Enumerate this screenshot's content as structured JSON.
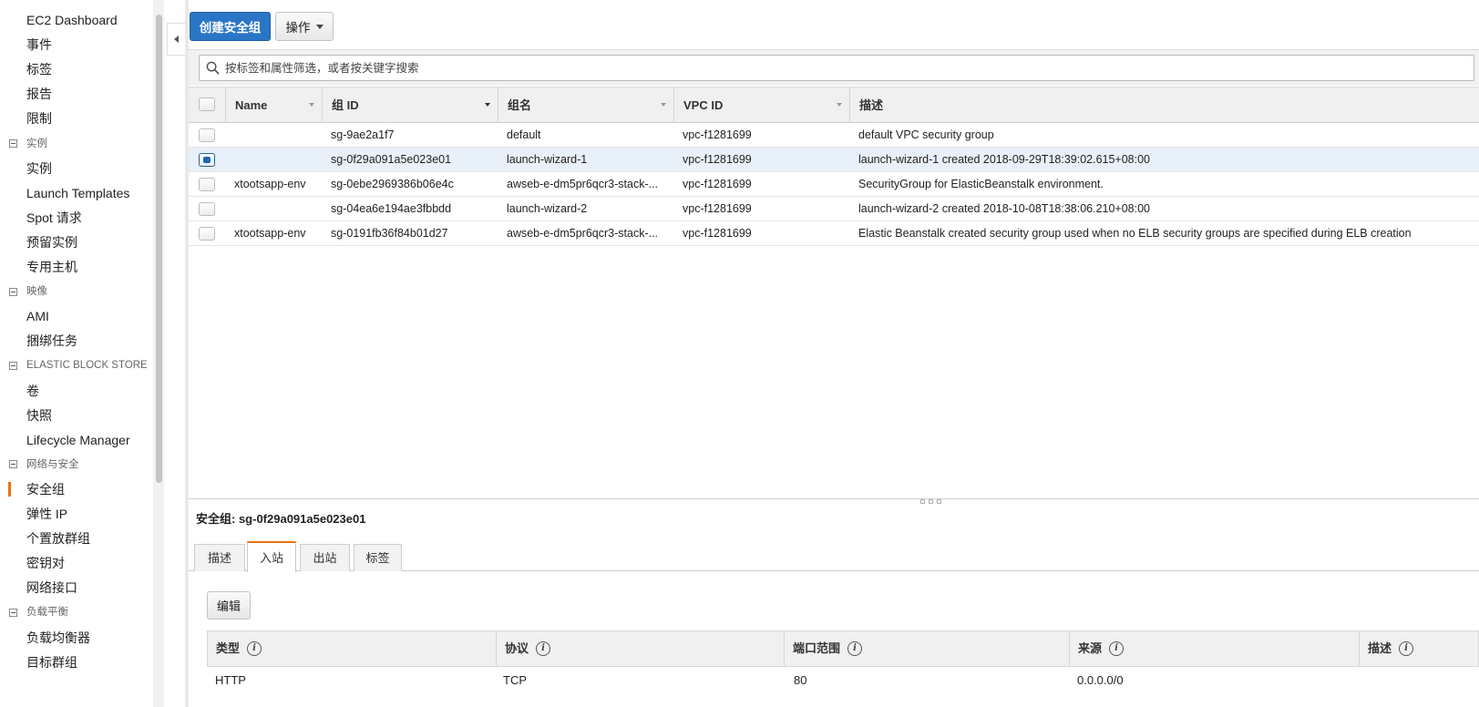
{
  "sidebar": {
    "items": [
      {
        "type": "item",
        "label": "EC2 Dashboard"
      },
      {
        "type": "item",
        "label": "事件"
      },
      {
        "type": "item",
        "label": "标签"
      },
      {
        "type": "item",
        "label": "报告"
      },
      {
        "type": "item",
        "label": "限制"
      },
      {
        "type": "section",
        "label": "实例"
      },
      {
        "type": "item",
        "label": "实例"
      },
      {
        "type": "item",
        "label": "Launch Templates"
      },
      {
        "type": "item",
        "label": "Spot 请求"
      },
      {
        "type": "item",
        "label": "预留实例"
      },
      {
        "type": "item",
        "label": "专用主机"
      },
      {
        "type": "section",
        "label": "映像"
      },
      {
        "type": "item",
        "label": "AMI"
      },
      {
        "type": "item",
        "label": "捆绑任务"
      },
      {
        "type": "section",
        "label": "ELASTIC BLOCK STORE"
      },
      {
        "type": "item",
        "label": "卷"
      },
      {
        "type": "item",
        "label": "快照"
      },
      {
        "type": "item",
        "label": "Lifecycle Manager"
      },
      {
        "type": "section",
        "label": "网络与安全"
      },
      {
        "type": "item",
        "label": "安全组",
        "active": true
      },
      {
        "type": "item",
        "label": "弹性 IP"
      },
      {
        "type": "item",
        "label": "个置放群组"
      },
      {
        "type": "item",
        "label": "密钥对"
      },
      {
        "type": "item",
        "label": "网络接口"
      },
      {
        "type": "section",
        "label": "负载平衡"
      },
      {
        "type": "item",
        "label": "负载均衡器"
      },
      {
        "type": "item",
        "label": "目标群组"
      }
    ]
  },
  "toolbar": {
    "create_label": "创建安全组",
    "actions_label": "操作"
  },
  "search": {
    "placeholder": "按标签和属性筛选，或者按关键字搜索"
  },
  "table": {
    "columns": [
      "Name",
      "组 ID",
      "组名",
      "VPC ID",
      "描述"
    ],
    "rows": [
      {
        "name": "",
        "group_id": "sg-9ae2a1f7",
        "group_name": "default",
        "vpc_id": "vpc-f1281699",
        "description": "default VPC security group",
        "selected": false
      },
      {
        "name": "",
        "group_id": "sg-0f29a091a5e023e01",
        "group_name": "launch-wizard-1",
        "vpc_id": "vpc-f1281699",
        "description": "launch-wizard-1 created 2018-09-29T18:39:02.615+08:00",
        "selected": true
      },
      {
        "name": "xtootsapp-env",
        "group_id": "sg-0ebe2969386b06e4c",
        "group_name": "awseb-e-dm5pr6qcr3-stack-...",
        "vpc_id": "vpc-f1281699",
        "description": "SecurityGroup for ElasticBeanstalk environment.",
        "selected": false
      },
      {
        "name": "",
        "group_id": "sg-04ea6e194ae3fbbdd",
        "group_name": "launch-wizard-2",
        "vpc_id": "vpc-f1281699",
        "description": "launch-wizard-2 created 2018-10-08T18:38:06.210+08:00",
        "selected": false
      },
      {
        "name": "xtootsapp-env",
        "group_id": "sg-0191fb36f84b01d27",
        "group_name": "awseb-e-dm5pr6qcr3-stack-...",
        "vpc_id": "vpc-f1281699",
        "description": "Elastic Beanstalk created security group used when no ELB security groups are specified during ELB creation",
        "selected": false
      }
    ]
  },
  "detail": {
    "title": "安全组: sg-0f29a091a5e023e01",
    "tabs": [
      {
        "label": "描述",
        "active": false
      },
      {
        "label": "入站",
        "active": true
      },
      {
        "label": "出站",
        "active": false
      },
      {
        "label": "标签",
        "active": false
      }
    ],
    "edit_label": "编辑",
    "rule_columns": [
      "类型",
      "协议",
      "端口范围",
      "来源",
      "描述"
    ],
    "rules": [
      {
        "type": "HTTP",
        "protocol": "TCP",
        "port_range": "80",
        "source": "0.0.0.0/0"
      }
    ]
  },
  "colors": {
    "primary_button": "#2a76c6",
    "active_accent": "#ec7211",
    "selected_row": "#e8f0f9"
  }
}
